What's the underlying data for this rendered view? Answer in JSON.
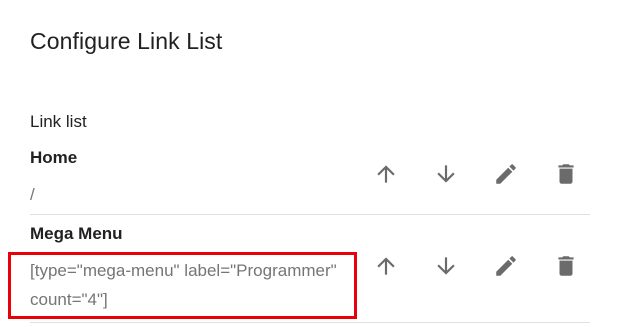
{
  "dialog": {
    "title": "Configure Link List"
  },
  "link_list": {
    "label": "Link list",
    "items": [
      {
        "name": "Home",
        "value": "/",
        "actions": [
          "arrow-up-icon",
          "arrow-down-icon",
          "pencil-icon",
          "trash-icon"
        ]
      },
      {
        "name": "Mega Menu",
        "value": "[type=\"mega-menu\" label=\"Programmer\" count=\"4\"]",
        "actions": [
          "arrow-up-icon",
          "arrow-down-icon",
          "pencil-icon",
          "trash-icon"
        ]
      }
    ]
  },
  "colors": {
    "highlight": "#e8000b",
    "icon": "#6b6b6b",
    "divider": "#e0e0e0"
  }
}
